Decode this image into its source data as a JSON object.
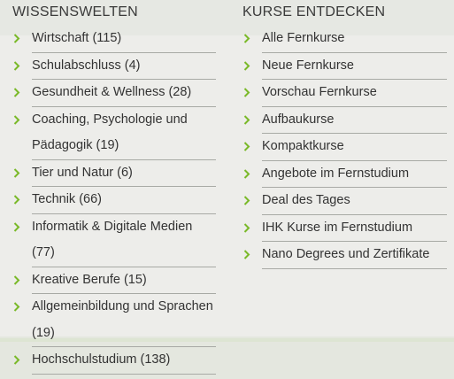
{
  "wissenswelten": {
    "heading": "WISSENSWELTEN",
    "items": [
      {
        "label": "Wirtschaft (115)"
      },
      {
        "label": "Schulabschluss (4)"
      },
      {
        "label": "Gesundheit & Wellness (28)"
      },
      {
        "label": "Coaching, Psychologie und Pädagogik (19)"
      },
      {
        "label": "Tier und Natur (6)"
      },
      {
        "label": "Technik (66)"
      },
      {
        "label": "Informatik & Digitale Medien (77)"
      },
      {
        "label": "Kreative Berufe (15)"
      },
      {
        "label": "Allgemeinbildung und Sprachen (19)"
      },
      {
        "label": "Hochschulstudium (138)"
      }
    ]
  },
  "kurse": {
    "heading": "KURSE ENTDECKEN",
    "items": [
      {
        "label": "Alle Fernkurse"
      },
      {
        "label": "Neue Fernkurse"
      },
      {
        "label": "Vorschau Fernkurse"
      },
      {
        "label": "Aufbaukurse"
      },
      {
        "label": "Kompaktkurse"
      },
      {
        "label": "Angebote im Fernstudium"
      },
      {
        "label": "Deal des Tages"
      },
      {
        "label": "IHK Kurse im Fernstudium"
      },
      {
        "label": "Nano Degrees und Zertifikate"
      }
    ]
  },
  "icons": {
    "bullet": "chevron-right-icon"
  },
  "colors": {
    "chevron": "#7ab929",
    "divider": "#a8aaa5",
    "text": "#333333"
  }
}
